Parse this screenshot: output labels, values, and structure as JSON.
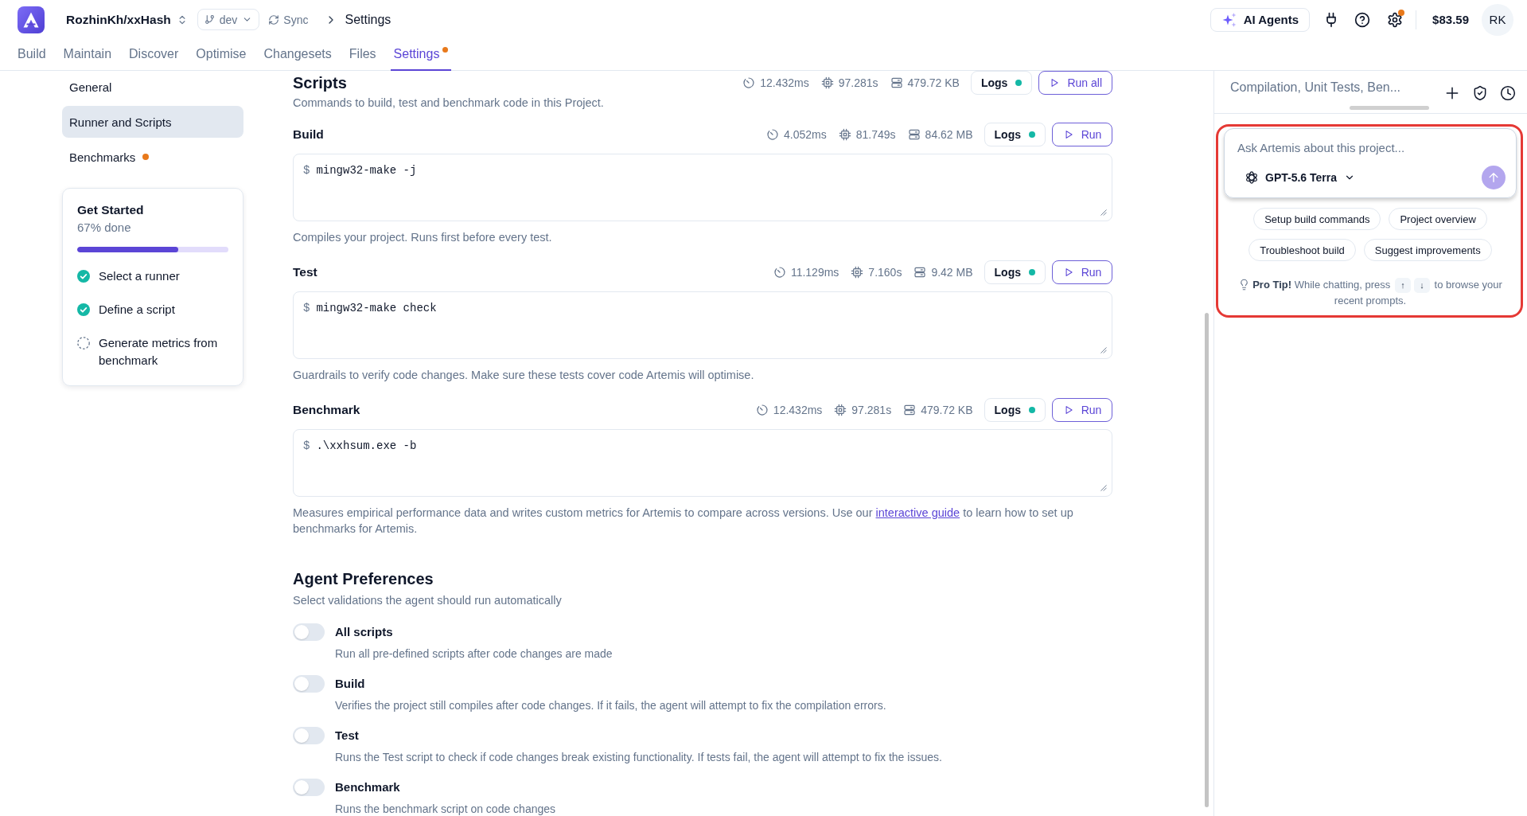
{
  "header": {
    "project": "RozhinKh/xxHash",
    "branch": "dev",
    "sync": "Sync",
    "breadcrumb": "Settings",
    "ai_agents": "AI Agents",
    "settings_dot": true,
    "balance": "$83.59",
    "avatar": "RK"
  },
  "tabs": [
    {
      "label": "Build",
      "selected": false,
      "dot": false
    },
    {
      "label": "Maintain",
      "selected": false,
      "dot": false
    },
    {
      "label": "Discover",
      "selected": false,
      "dot": false
    },
    {
      "label": "Optimise",
      "selected": false,
      "dot": false
    },
    {
      "label": "Changesets",
      "selected": false,
      "dot": false
    },
    {
      "label": "Files",
      "selected": false,
      "dot": false
    },
    {
      "label": "Settings",
      "selected": true,
      "dot": true
    }
  ],
  "sidebar": {
    "items": [
      {
        "label": "General",
        "selected": false,
        "dot": false
      },
      {
        "label": "Runner and Scripts",
        "selected": true,
        "dot": false
      },
      {
        "label": "Benchmarks",
        "selected": false,
        "dot": true
      }
    ],
    "get_started": {
      "title": "Get Started",
      "progress_text": "67% done",
      "level": 0.67,
      "steps": [
        {
          "label": "Select a runner",
          "checked": true
        },
        {
          "label": "Define a script",
          "checked": true
        },
        {
          "label": "Generate metrics from benchmark",
          "checked": false
        }
      ]
    }
  },
  "scripts": {
    "title": "Scripts",
    "description": "Commands to build, test and benchmark code in this Project.",
    "metrics": [
      {
        "kind": "time",
        "value": "12.432ms"
      },
      {
        "kind": "cpu",
        "value": "97.281s"
      },
      {
        "kind": "memory",
        "value": "479.72 KB"
      }
    ],
    "logs": {
      "label": "Logs",
      "ready": true
    },
    "run": "Run all",
    "items": [
      {
        "name": "Build",
        "metrics": [
          {
            "kind": "time",
            "value": "4.052ms"
          },
          {
            "kind": "cpu",
            "value": "81.749s"
          },
          {
            "kind": "memory",
            "value": "84.62 MB"
          }
        ],
        "logs": {
          "label": "Logs",
          "ready": true
        },
        "run": "Run",
        "prompt": "$",
        "command": "mingw32-make -j",
        "description": "Compiles your project. Runs first before every test."
      },
      {
        "name": "Test",
        "metrics": [
          {
            "kind": "time",
            "value": "11.129ms"
          },
          {
            "kind": "cpu",
            "value": "7.160s"
          },
          {
            "kind": "memory",
            "value": "9.42 MB"
          }
        ],
        "logs": {
          "label": "Logs",
          "ready": true
        },
        "run": "Run",
        "prompt": "$",
        "command": "mingw32-make check",
        "description": "Guardrails to verify code changes. Make sure these tests cover code Artemis will optimise."
      },
      {
        "name": "Benchmark",
        "metrics": [
          {
            "kind": "time",
            "value": "12.432ms"
          },
          {
            "kind": "cpu",
            "value": "97.281s"
          },
          {
            "kind": "memory",
            "value": "479.72 KB"
          }
        ],
        "logs": {
          "label": "Logs",
          "ready": true
        },
        "run": "Run",
        "prompt": "$",
        "command": ".\\xxhsum.exe -b",
        "description": "Measures empirical performance data and writes custom metrics for Artemis to compare across versions. Use our",
        "link": "interactive guide",
        "description_after": "to learn how to set up benchmarks for Artemis."
      }
    ]
  },
  "agent_preferences": {
    "title": "Agent Preferences",
    "subtitle": "Select validations the agent should run automatically",
    "toggles": [
      {
        "label": "All scripts",
        "description": "Run all pre-defined scripts after code changes are made",
        "on": false
      },
      {
        "label": "Build",
        "description": "Verifies the project still compiles after code changes. If it fails, the agent will attempt to fix the compilation errors.",
        "on": false
      },
      {
        "label": "Test",
        "description": "Runs the Test script to check if code changes break existing functionality. If tests fail, the agent will attempt to fix the issues.",
        "on": false
      },
      {
        "label": "Benchmark",
        "description": "Runs the benchmark script on code changes",
        "on": false
      }
    ]
  },
  "assistant": {
    "title": "Compilation, Unit Tests, Ben...",
    "placeholder": "Ask Artemis about this project...",
    "model": "GPT-5.6 Terra",
    "suggestions": [
      [
        "Setup build commands",
        "Project overview"
      ],
      [
        "Troubleshoot build",
        "Suggest improvements"
      ]
    ],
    "tip": {
      "text": "**Pro Tip!** While chatting, press",
      "keys": [
        "↑",
        "↓"
      ],
      "text_after": "to browse your recent prompts."
    }
  }
}
